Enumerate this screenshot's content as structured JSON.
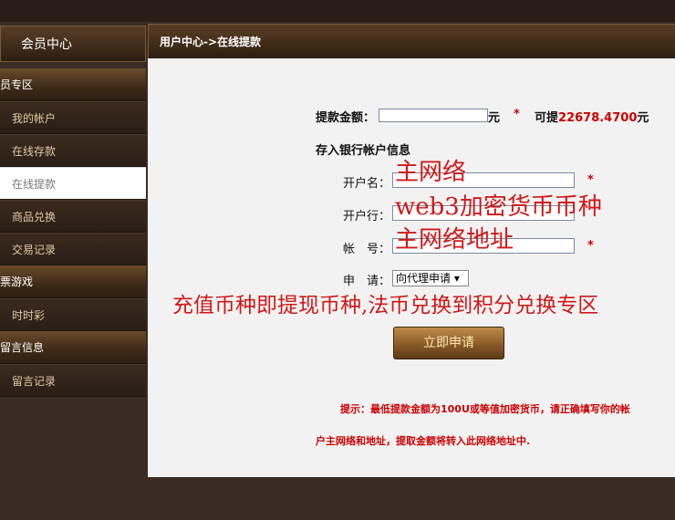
{
  "sidebar": {
    "title": "会员中心",
    "items": [
      {
        "type": "cat",
        "label": "员专区"
      },
      {
        "type": "sub",
        "label": "我的帐户"
      },
      {
        "type": "sub",
        "label": "在线存款"
      },
      {
        "type": "sub",
        "label": "在线提款",
        "active": true
      },
      {
        "type": "sub",
        "label": "商品兑换"
      },
      {
        "type": "sub",
        "label": "交易记录"
      },
      {
        "type": "cat",
        "label": "票游戏"
      },
      {
        "type": "sub",
        "label": "时时彩"
      },
      {
        "type": "cat",
        "label": "留言信息"
      },
      {
        "type": "sub",
        "label": "留言记录"
      }
    ]
  },
  "header": {
    "breadcrumb": "用户中心->在线提款"
  },
  "form": {
    "amount_label": "提款金额：",
    "amount_value": "",
    "amount_unit": "元",
    "star": "*",
    "available_prefix": "可提",
    "available_amount": "22678.4700",
    "available_unit": "元",
    "section_title": "存入银行帐户信息",
    "holder_label": "开户名：",
    "holder_value": "",
    "bank_label": "开户行：",
    "bank_value": "",
    "account_label": "帐　号：",
    "account_value": "",
    "apply_label": "申　请：",
    "apply_select": "向代理申请 ▾",
    "submit_label": "立即申请"
  },
  "overlays": {
    "holder_note": "主网络",
    "bank_note": "web3加密货币币种",
    "account_note": "主网络地址",
    "currency_note": "充值币种即提现币种,法币兑换到积分兑换专区"
  },
  "tip": {
    "line1": "提示：最低提款金额为100U或等值加密货币，请正确填写你的帐",
    "line2": "户主网络和地址，提取金额将转入此网络地址中."
  },
  "colors": {
    "accent_red": "#d01818",
    "sidebar_bg": "#3a2b23",
    "panel_bg": "#f2f2f2"
  }
}
